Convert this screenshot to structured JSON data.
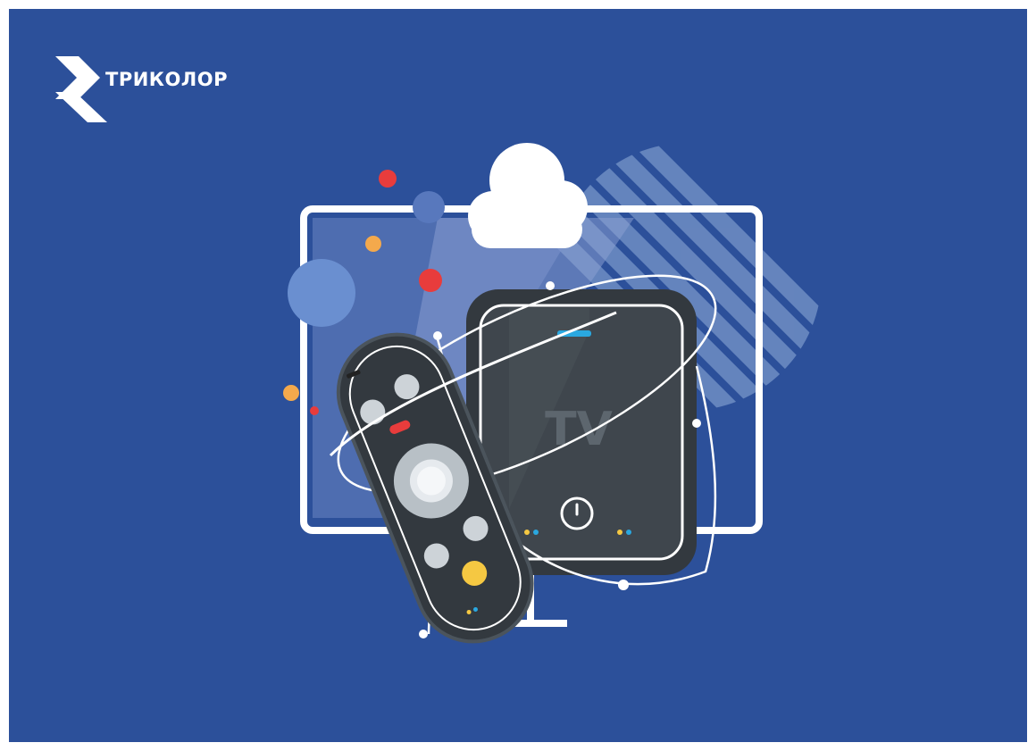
{
  "brand": {
    "name": "ТРИКОЛОР",
    "logo_icon": "tricolor-chevron-logo"
  },
  "illustration": {
    "device_label": "TV",
    "icons": [
      "cloud-icon",
      "power-icon",
      "remote-control",
      "tv-box",
      "monitor"
    ]
  },
  "colors": {
    "background": "#2c509a",
    "device_dark": "#33393f",
    "accent_red": "#e83c3c",
    "accent_yellow": "#f5c842",
    "accent_blue": "#2aa8e0",
    "accent_orange": "#f4a94c"
  }
}
